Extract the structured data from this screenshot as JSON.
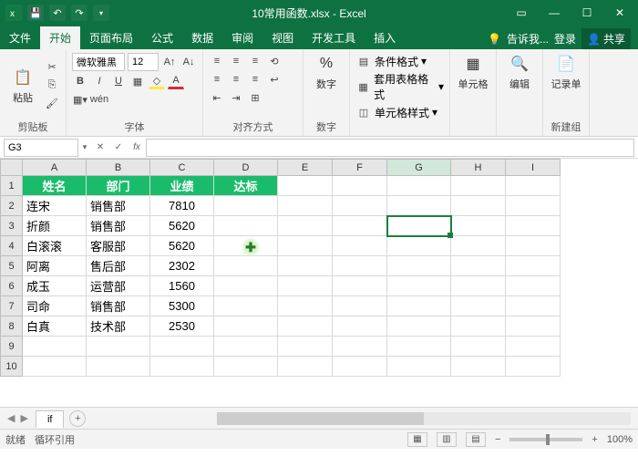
{
  "title": "10常用函数.xlsx - Excel",
  "tabs": {
    "file": "文件",
    "home": "开始",
    "layout": "页面布局",
    "formulas": "公式",
    "data": "数据",
    "review": "审阅",
    "view": "视图",
    "dev": "开发工具",
    "insert": "插入"
  },
  "tellme": "告诉我...",
  "login": "登录",
  "share": "共享",
  "ribbon": {
    "clipboard": {
      "paste": "粘贴",
      "label": "剪贴板"
    },
    "font": {
      "name": "微软雅黑",
      "size": "12",
      "label": "字体"
    },
    "align": {
      "label": "对齐方式"
    },
    "number": {
      "btn": "数字",
      "label": "数字"
    },
    "styles": {
      "cond": "条件格式",
      "format_table": "套用表格格式",
      "cell_styles": "单元格样式"
    },
    "cells": {
      "label": "单元格"
    },
    "editing": {
      "label": "编辑"
    },
    "record": {
      "btn": "记录单",
      "label": "新建组"
    }
  },
  "namebox": "G3",
  "fx": "fx",
  "cols": [
    "A",
    "B",
    "C",
    "D",
    "E",
    "F",
    "G",
    "H",
    "I"
  ],
  "header": [
    "姓名",
    "部门",
    "业绩",
    "达标"
  ],
  "rows": [
    [
      "连宋",
      "销售部",
      "7810",
      ""
    ],
    [
      "折颜",
      "销售部",
      "5620",
      ""
    ],
    [
      "白滚滚",
      "客服部",
      "5620",
      ""
    ],
    [
      "阿离",
      "售后部",
      "2302",
      ""
    ],
    [
      "成玉",
      "运营部",
      "1560",
      ""
    ],
    [
      "司命",
      "销售部",
      "5300",
      ""
    ],
    [
      "白真",
      "技术部",
      "2530",
      ""
    ]
  ],
  "sheet": "if",
  "status": {
    "ready": "就绪",
    "circ": "循环引用",
    "zoom": "100%"
  }
}
